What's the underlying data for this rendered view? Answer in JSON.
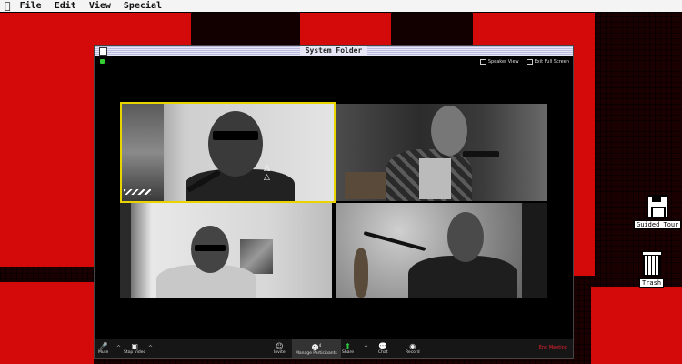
{
  "menubar": {
    "apple": "",
    "items": [
      "File",
      "Edit",
      "View",
      "Special"
    ]
  },
  "window": {
    "title": "System Folder",
    "speaker_view": "Speaker View",
    "exit_full_screen": "Exit Full Screen"
  },
  "video_tiles": [
    {
      "id": "t1",
      "active_speaker": true
    },
    {
      "id": "t2",
      "active_speaker": false
    },
    {
      "id": "t3",
      "active_speaker": false
    },
    {
      "id": "t4",
      "active_speaker": false
    }
  ],
  "toolbar": {
    "mute": "Mute",
    "stop_video": "Stop Video",
    "invite": "Invite",
    "manage_participants": "Manage Participants",
    "participant_count": "4",
    "share": "Share",
    "chat": "Chat",
    "record": "Record",
    "end_meeting": "End Meeting"
  },
  "desktop_icons": {
    "guided_tour": "Guided Tour",
    "trash": "Trash"
  },
  "colors": {
    "background_red": "#d40a0a",
    "active_speaker_border": "#e9d400",
    "end_meeting": "#e22233",
    "share_green": "#2ecc40"
  }
}
